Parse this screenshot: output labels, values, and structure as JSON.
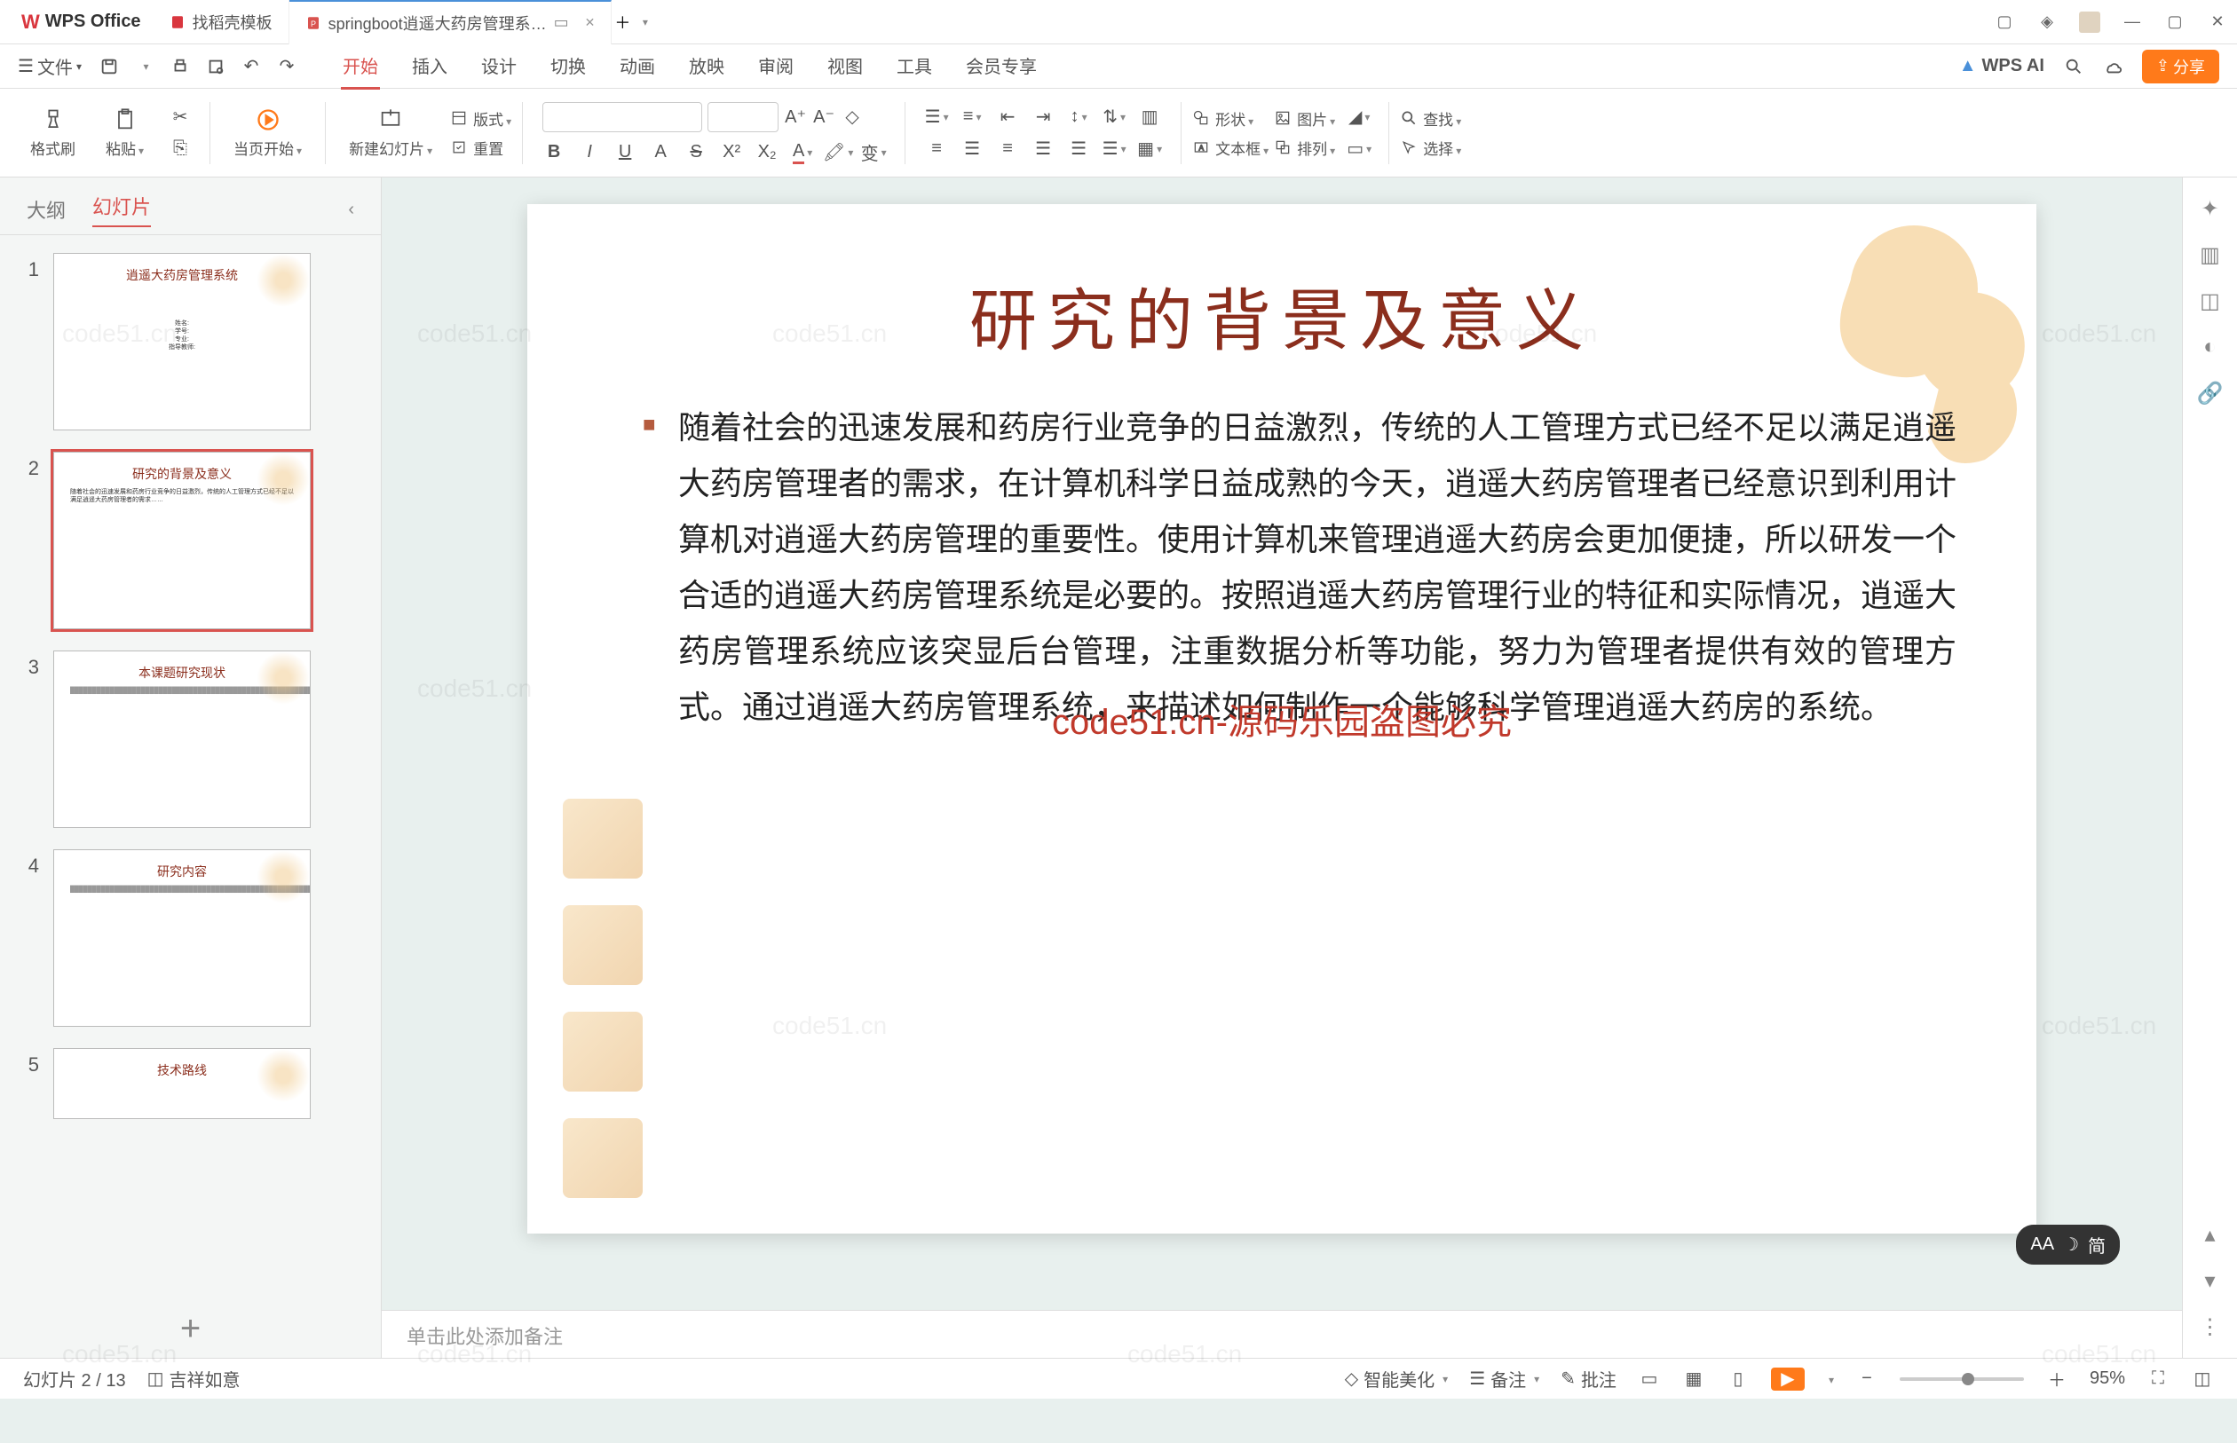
{
  "appName": "WPS Office",
  "tabs": [
    {
      "label": "找稻壳模板",
      "active": false
    },
    {
      "label": "springboot逍遥大药房管理系…",
      "active": true
    }
  ],
  "menubar": {
    "fileLabel": "文件",
    "items": [
      "开始",
      "插入",
      "设计",
      "切换",
      "动画",
      "放映",
      "审阅",
      "视图",
      "工具",
      "会员专享"
    ],
    "activeIndex": 0,
    "wpsAi": "WPS AI",
    "shareLabel": "分享"
  },
  "ribbon": {
    "formatBrush": "格式刷",
    "paste": "粘贴",
    "fromCurrent": "当页开始",
    "newSlide": "新建幻灯片",
    "layout": "版式",
    "reset": "重置",
    "shape": "形状",
    "picture": "图片",
    "textbox": "文本框",
    "arrange": "排列",
    "find": "查找",
    "select": "选择"
  },
  "sidebar": {
    "outlineTab": "大纲",
    "slidesTab": "幻灯片",
    "thumbs": [
      {
        "num": "1",
        "title": "逍遥大药房管理系统",
        "subtitle": "姓名:\n学号:\n专业:\n指导教师:"
      },
      {
        "num": "2",
        "title": "研究的背景及意义",
        "selected": true
      },
      {
        "num": "3",
        "title": "本课题研究现状"
      },
      {
        "num": "4",
        "title": "研究内容"
      },
      {
        "num": "5",
        "title": "技术路线"
      }
    ],
    "addSlide": "+"
  },
  "slide": {
    "title": "研究的背景及意义",
    "body": "随着社会的迅速发展和药房行业竞争的日益激烈，传统的人工管理方式已经不足以满足逍遥大药房管理者的需求，在计算机科学日益成熟的今天，逍遥大药房管理者已经意识到利用计算机对逍遥大药房管理的重要性。使用计算机来管理逍遥大药房会更加便捷，所以研发一个合适的逍遥大药房管理系统是必要的。按照逍遥大药房管理行业的特征和实际情况，逍遥大药房管理系统应该突显后台管理，注重数据分析等功能，努力为管理者提供有效的管理方式。通过逍遥大药房管理系统，来描述如何制作一个能够科学管理逍遥大药房的系统。",
    "overlayText": "code51.cn-源码乐园盗图必究"
  },
  "notesPlaceholder": "单击此处添加备注",
  "statusbar": {
    "slideCount": "幻灯片 2 / 13",
    "theme": "吉祥如意",
    "beautify": "智能美化",
    "notes": "备注",
    "comments": "批注",
    "zoomValue": "95%"
  },
  "floatPill": {
    "aa": "AA",
    "lang": "简"
  },
  "watermark": "code51.cn"
}
